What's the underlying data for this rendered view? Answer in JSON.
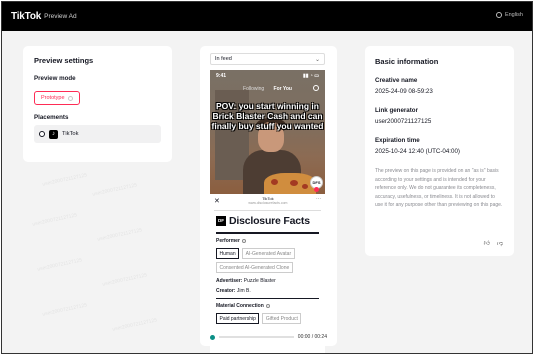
{
  "header": {
    "logo": "TikTok",
    "logo_sub": "Preview Ad",
    "language": "English"
  },
  "settings": {
    "title": "Preview settings",
    "mode_label": "Preview mode",
    "mode_value": "Prototype",
    "placements_label": "Placements",
    "placement_value": "TikTok"
  },
  "preview": {
    "feed_select": "In feed",
    "status_time": "9:41",
    "tab_following": "Following",
    "tab_foryou": "For You",
    "caption": "POV: you start winning in Brick Blaster Cash and can finally buy stuff you  wanted",
    "avatar_text": "DFS",
    "sheet_brand": "TikTok",
    "sheet_url": "www.disclosurefacts.com",
    "df_logo": "DF",
    "df_title": "Disclosure Facts",
    "performer_label": "Performer",
    "performer_chips": [
      {
        "label": "Human",
        "selected": true
      },
      {
        "label": "AI-Generated Avatar",
        "selected": false
      },
      {
        "label": "Consented AI-Generated Clone",
        "selected": false
      }
    ],
    "advertiser_key": "Advertiser:",
    "advertiser_value": "Puzzle Blaster",
    "creator_key": "Creator:",
    "creator_value": "Jim B.",
    "material_label": "Material Connection",
    "material_chips": [
      {
        "label": "Paid partnership",
        "selected": true
      },
      {
        "label": "Gifted Product",
        "selected": false
      }
    ],
    "time": "00:00 / 00:24"
  },
  "info": {
    "title": "Basic information",
    "creative_name_label": "Creative name",
    "creative_name_value": "2025-24-09 08-59:23",
    "link_generator_label": "Link generator",
    "link_generator_value": "user2000721127125",
    "expiration_label": "Expiration time",
    "expiration_value": "2025-10-24 12:40 (UTC-04:00)",
    "disclaimer": "The preview on this page is provided on an \"as is\" basis according to your settings and is intended for your reference only. We do not guarantee its completeness, accuracy, usefulness, or timeliness. It is not allowed to use it for any purpose other than previewing on this page."
  },
  "watermark": "user2000721127125"
}
